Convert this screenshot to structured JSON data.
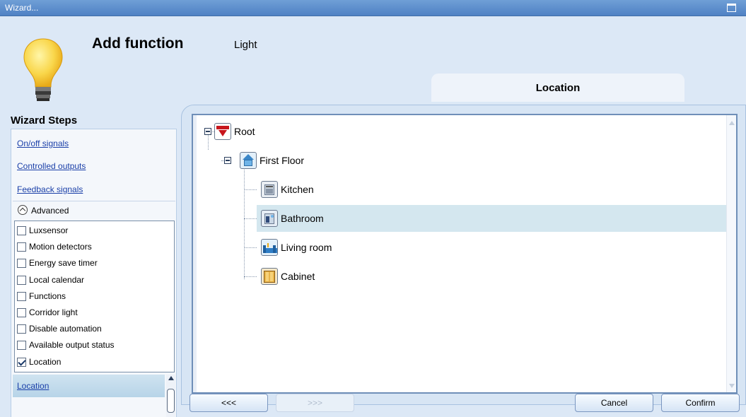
{
  "window": {
    "title": "Wizard..."
  },
  "header": {
    "title": "Add function",
    "subtitle": "Light",
    "section_tab": "Location"
  },
  "wizard_steps": {
    "title": "Wizard Steps",
    "links": [
      "On/off signals",
      "Controlled outputs",
      "Feedback signals"
    ],
    "advanced_label": "Advanced",
    "options": [
      {
        "label": "Luxsensor",
        "checked": false
      },
      {
        "label": "Motion detectors",
        "checked": false
      },
      {
        "label": "Energy save timer",
        "checked": false
      },
      {
        "label": "Local calendar",
        "checked": false
      },
      {
        "label": "Functions",
        "checked": false
      },
      {
        "label": "Corridor light",
        "checked": false
      },
      {
        "label": "Disable automation",
        "checked": false
      },
      {
        "label": "Available output status",
        "checked": false
      },
      {
        "label": "Location",
        "checked": true
      }
    ],
    "current_step": "Location"
  },
  "tree": {
    "root": "Root",
    "first_floor": "First Floor",
    "rooms": [
      "Kitchen",
      "Bathroom",
      "Living room",
      "Cabinet"
    ],
    "selected": "Bathroom"
  },
  "footer": {
    "back": "<<<",
    "next": ">>>",
    "cancel": "Cancel",
    "confirm": "Confirm"
  },
  "colors": {
    "titlebar": "#5a8ccb",
    "panel_bg": "#dce8f6",
    "selection": "#d4e7ef",
    "link": "#1a3fa8"
  }
}
